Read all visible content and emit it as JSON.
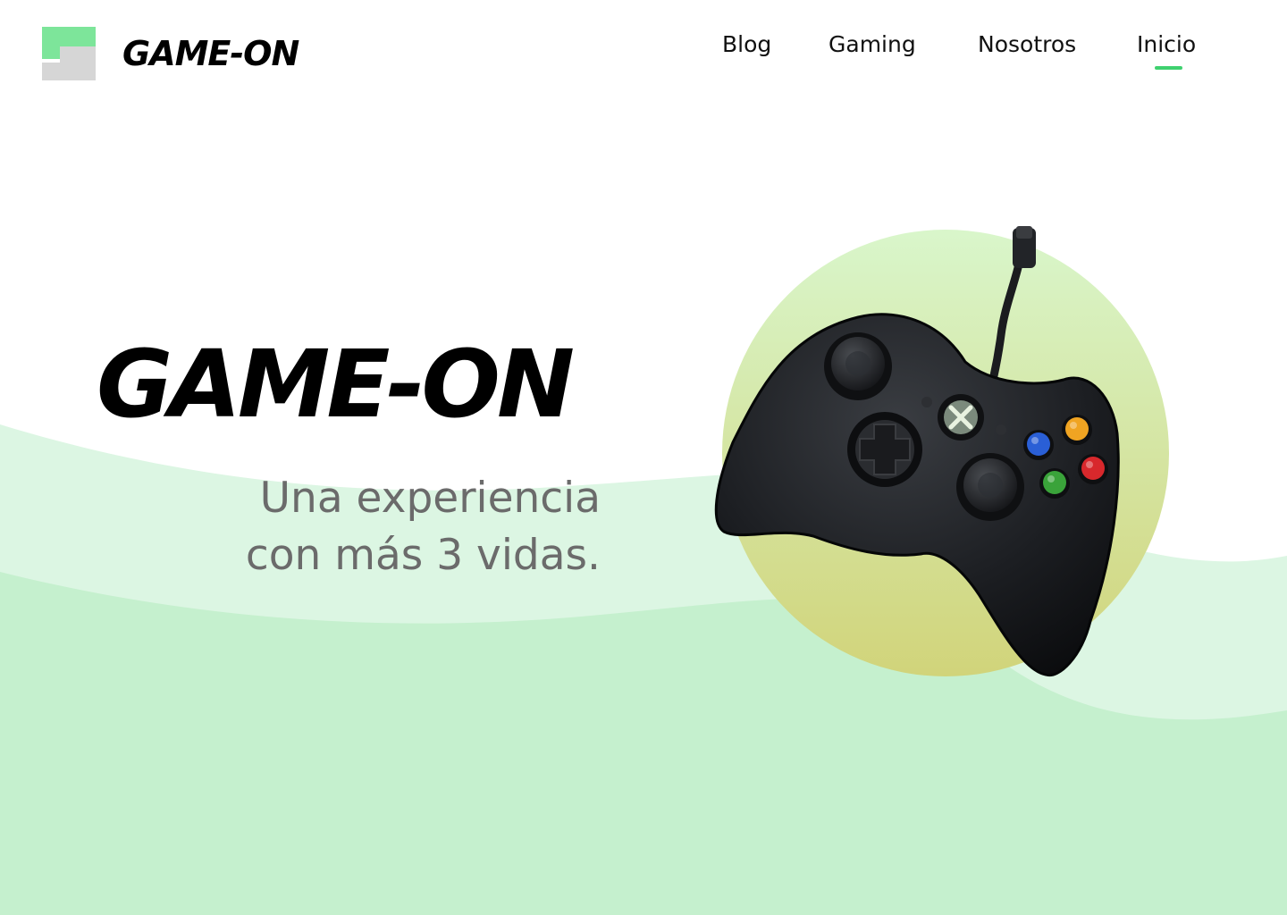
{
  "header": {
    "brand": "GAME-ON",
    "logo_icon": "stacked-blocks-logo-icon"
  },
  "nav": {
    "items": [
      {
        "label": "Blog",
        "active": false
      },
      {
        "label": "Gaming",
        "active": false
      },
      {
        "label": "Nosotros",
        "active": false
      },
      {
        "label": "Inicio",
        "active": true
      }
    ],
    "active_indicator_color": "#3fd16f"
  },
  "hero": {
    "title": "GAME-ON",
    "subtitle_line1": "Una experiencia",
    "subtitle_line2": "con más 3 vidas.",
    "image": "game-controller-icon"
  },
  "colors": {
    "accent_green": "#3fd16f",
    "wave_light": "#dbf6e2",
    "wave_main": "#c5f0d0",
    "circle_top": "#d9f5c8",
    "circle_bottom": "#d2d67a",
    "subtitle_gray": "#6b6b6b"
  }
}
